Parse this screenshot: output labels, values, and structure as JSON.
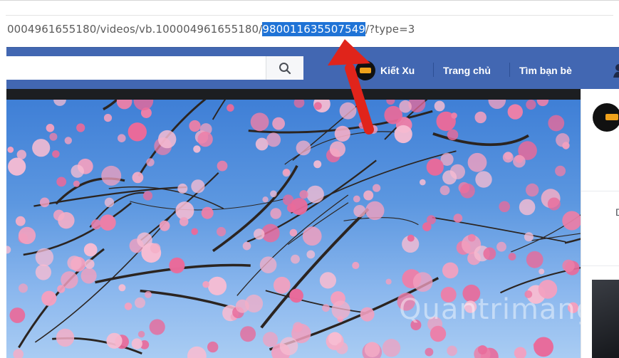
{
  "browser": {
    "url_prefix": "0004961655180/videos/vb.100004961655180/",
    "url_selected": "980011635507549",
    "url_suffix": "/?type=3"
  },
  "header": {
    "search_icon": "search-icon",
    "profile_name": "Kiết Xu",
    "nav_home": "Trang chủ",
    "nav_find_friends": "Tìm bạn bè"
  },
  "side_panel": {
    "glyph": "D"
  },
  "watermark": {
    "text": "uantrimang"
  },
  "colors": {
    "facebook_blue": "#4267b2",
    "selection_blue": "#1f73d6",
    "arrow_red": "#e0241b"
  }
}
